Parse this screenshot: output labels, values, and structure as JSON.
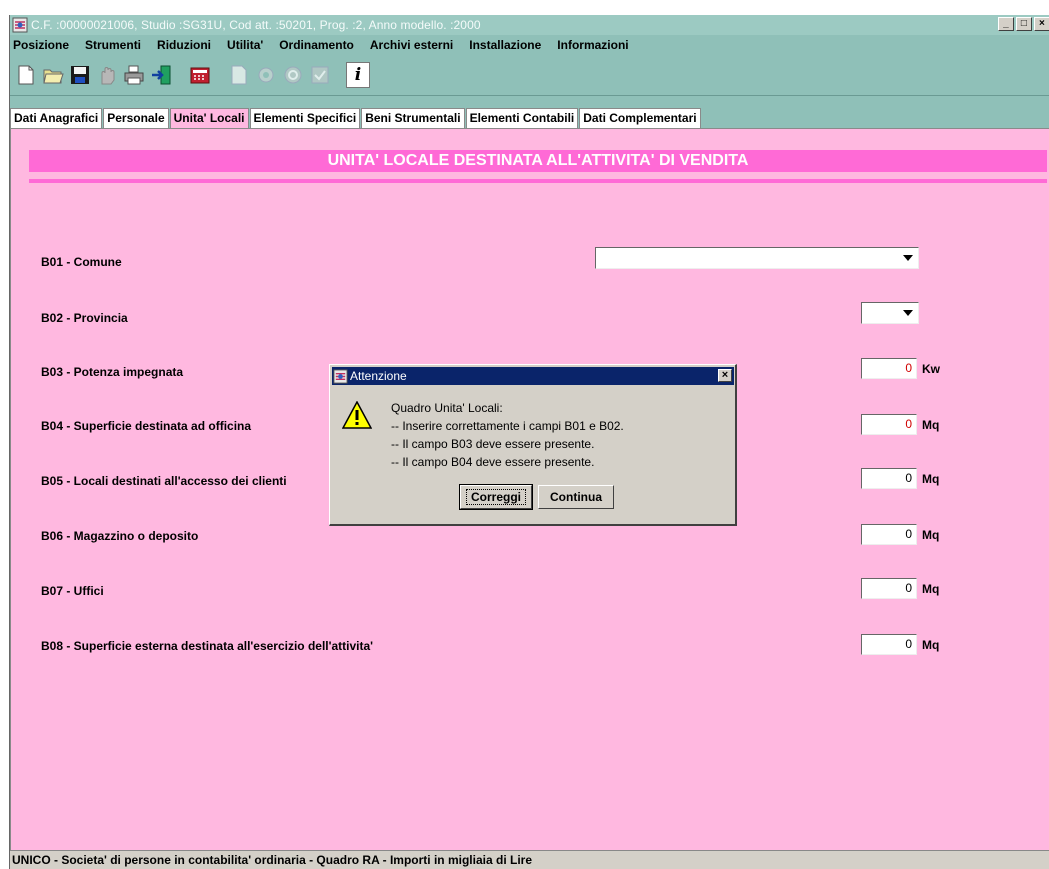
{
  "window": {
    "title": "C.F. :00000021006, Studio :SG31U, Cod att. :50201, Prog. :2, Anno modello. :2000",
    "controls": [
      "_",
      "□",
      "×"
    ]
  },
  "menu": [
    "Posizione",
    "Strumenti",
    "Riduzioni",
    "Utilita'",
    "Ordinamento",
    "Archivi esterni",
    "Installazione",
    "Informazioni"
  ],
  "toolbar": {
    "icons": [
      "new-document-icon",
      "open-folder-icon",
      "save-disk-icon",
      "hand-icon",
      "print-icon",
      "exit-icon",
      "calculator-icon",
      "copy-document-icon",
      "settings-icon",
      "refresh-icon",
      "check-icon",
      "info-icon"
    ],
    "info_label": "i"
  },
  "tabs": [
    {
      "label": "Dati Anagrafici",
      "active": false
    },
    {
      "label": "Personale",
      "active": false
    },
    {
      "label": "Unita' Locali",
      "active": true
    },
    {
      "label": "Elementi Specifici",
      "active": false
    },
    {
      "label": "Beni Strumentali",
      "active": false
    },
    {
      "label": "Elementi Contabili",
      "active": false
    },
    {
      "label": "Dati Complementari",
      "active": false
    }
  ],
  "section": {
    "title": "UNITA' LOCALE DESTINATA ALL'ATTIVITA' DI VENDITA"
  },
  "fields": {
    "b01": {
      "label": "B01 - Comune",
      "value": ""
    },
    "b02": {
      "label": "B02 - Provincia",
      "value": ""
    },
    "b03": {
      "label": "B03 - Potenza impegnata",
      "value": "0",
      "unit": "Kw"
    },
    "b04": {
      "label": "B04 - Superficie destinata ad officina",
      "value": "0",
      "unit": "Mq"
    },
    "b05": {
      "label": "B05 - Locali destinati all'accesso dei clienti",
      "value": "0",
      "unit": "Mq"
    },
    "b06": {
      "label": "B06 - Magazzino o deposito",
      "value": "0",
      "unit": "Mq"
    },
    "b07": {
      "label": "B07 - Uffici",
      "value": "0",
      "unit": "Mq"
    },
    "b08": {
      "label": "B08 - Superficie esterna destinata all'esercizio dell'attivita'",
      "value": "0",
      "unit": "Mq"
    }
  },
  "dialog": {
    "title": "Attenzione",
    "close": "×",
    "icon": "warning-icon",
    "lines": [
      "Quadro Unita' Locali:",
      "-- Inserire correttamente i campi B01 e B02.",
      "-- Il campo B03 deve essere presente.",
      "-- Il campo B04 deve essere presente."
    ],
    "buttons": {
      "correct": "Correggi",
      "continue": "Continua"
    }
  },
  "status": "UNICO - Societa' di persone in contabilita' ordinaria - Quadro RA - Importi in migliaia di Lire",
  "colors": {
    "panel": "#ffb8e0",
    "header": "#ff6ad6",
    "chrome": "#8fc0b8",
    "dialog_title": "#0a246a",
    "error_text": "#d00000"
  }
}
